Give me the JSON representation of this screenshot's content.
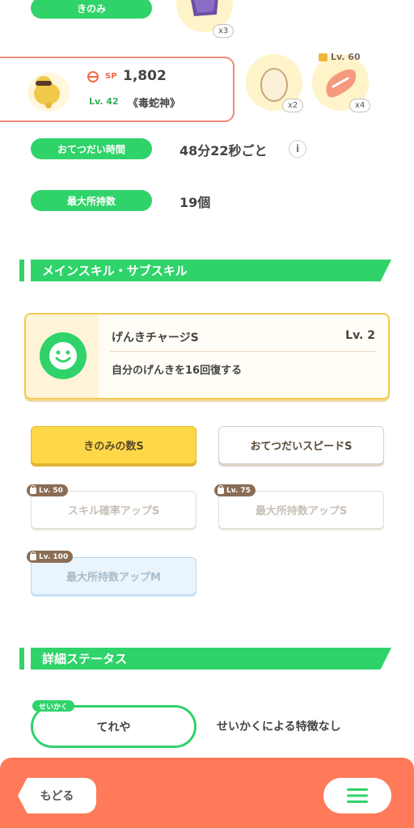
{
  "ingredients_row": {
    "label": "きのみ",
    "top_item_qty": "x3"
  },
  "pokemon_card": {
    "sp_label": "SP",
    "sp_value": "1,802",
    "level": "Lv. 42",
    "title": "《毒蛇神》",
    "items": [
      {
        "icon": "egg-icon",
        "qty": "x2"
      },
      {
        "icon": "sausage-icon",
        "qty": "x4",
        "lock_level": "Lv. 60"
      }
    ]
  },
  "help_time": {
    "label": "おてつだい時間",
    "value": "48分22秒ごと",
    "info_icon": "info-icon"
  },
  "max_carry": {
    "label": "最大所持数",
    "value": "19個"
  },
  "skills_section": {
    "title": "メインスキル・サブスキル",
    "main_skill": {
      "name": "げんきチャージS",
      "level": "Lv. 2",
      "description": "自分のげんきを16回復する",
      "icon": "smile-icon"
    },
    "sub_skills": [
      {
        "label": "きのみの数S",
        "state": "selected"
      },
      {
        "label": "おてつだいスピードS",
        "state": "unlocked"
      },
      {
        "label": "スキル確率アップS",
        "state": "locked",
        "lock_level": "Lv. 50"
      },
      {
        "label": "最大所持数アップS",
        "state": "locked",
        "lock_level": "Lv. 75"
      },
      {
        "label": "最大所持数アップM",
        "state": "locked",
        "lock_level": "Lv. 100"
      }
    ]
  },
  "details_section": {
    "title": "詳細ステータス",
    "nature_tag": "せいかく",
    "nature_value": "てれや",
    "nature_effect": "せいかくによる特徴なし"
  },
  "footer": {
    "back_label": "もどる",
    "menu_icon": "menu-icon"
  },
  "colors": {
    "green": "#2fd36a",
    "orange": "#ff7a59",
    "yellow": "#ffd84a"
  }
}
